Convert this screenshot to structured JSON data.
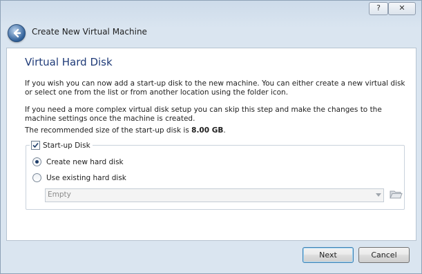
{
  "window": {
    "title": "Create New Virtual Machine",
    "help_glyph": "?",
    "close_glyph": "✕"
  },
  "page": {
    "heading": "Virtual Hard Disk",
    "para1": "If you wish you can now add a start-up disk to the new machine. You can either create a new virtual disk or select one from the list or from another location using the folder icon.",
    "para2": "If you need a more complex virtual disk setup you can skip this step and make the changes to the machine settings once the machine is created.",
    "para3_prefix": "The recommended size of the start-up disk is ",
    "para3_value": "8.00 GB",
    "para3_suffix": "."
  },
  "startup_disk": {
    "label": "Start-up Disk",
    "checked": true,
    "options": [
      {
        "label": "Create new hard disk",
        "selected": true
      },
      {
        "label": "Use existing hard disk",
        "selected": false
      }
    ],
    "existing_disk_value": "Empty"
  },
  "buttons": {
    "next": "Next",
    "cancel": "Cancel"
  },
  "colors": {
    "heading": "#1f3b78",
    "default_button_border": "#3c7fb1"
  }
}
